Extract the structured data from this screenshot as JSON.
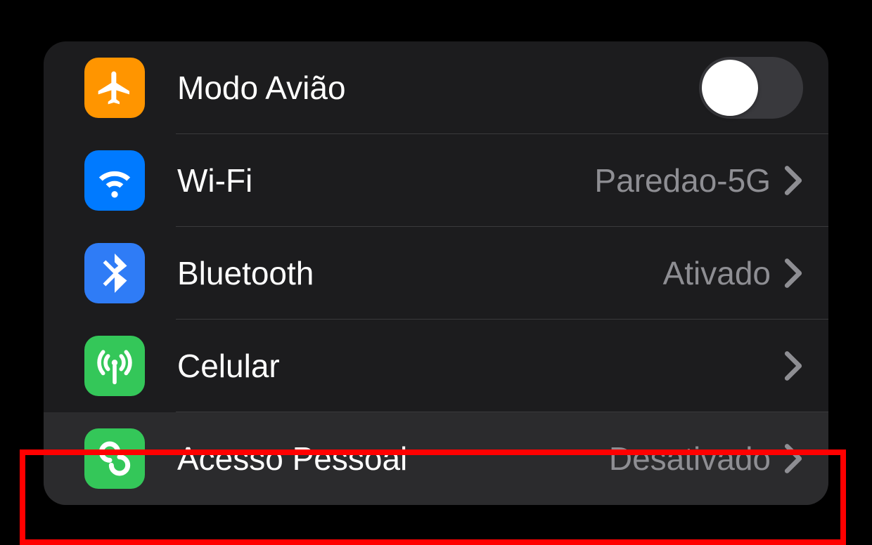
{
  "rows": {
    "airplane": {
      "label": "Modo Avião",
      "toggle_on": false
    },
    "wifi": {
      "label": "Wi-Fi",
      "value": "Paredao-5G"
    },
    "bluetooth": {
      "label": "Bluetooth",
      "value": "Ativado"
    },
    "cellular": {
      "label": "Celular"
    },
    "hotspot": {
      "label": "Acesso Pessoal",
      "value": "Desativado",
      "highlighted": true
    }
  },
  "colors": {
    "orange": "#ff9500",
    "blue": "#007aff",
    "green": "#34c759",
    "grey": "#8e8e93"
  }
}
